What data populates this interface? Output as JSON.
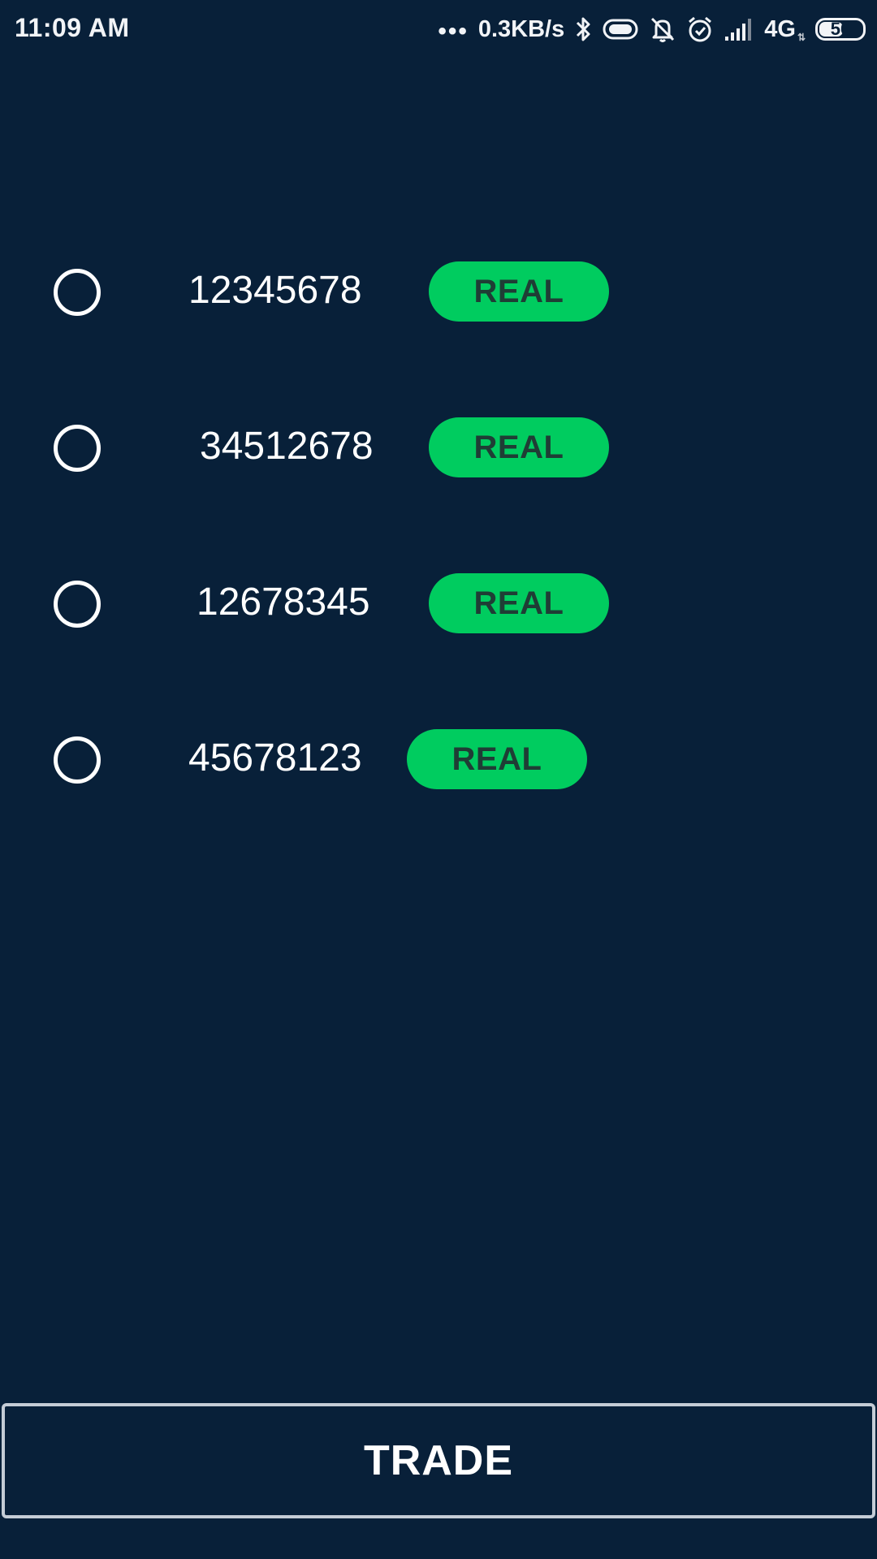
{
  "status_bar": {
    "time": "11:09 AM",
    "dots": "•••",
    "network_speed": "0.3KB/s",
    "network_type": "4G",
    "battery_level": "56",
    "battery_fraction": 0.56,
    "icons": [
      "bluetooth-icon",
      "vibrate-icon",
      "mute-bell-icon",
      "alarm-icon",
      "signal-icon",
      "battery-icon"
    ]
  },
  "accounts": [
    {
      "number": "12345678",
      "badge": "REAL",
      "selected": false
    },
    {
      "number": "34512678",
      "badge": "REAL",
      "selected": false
    },
    {
      "number": "12678345",
      "badge": "REAL",
      "selected": false
    },
    {
      "number": "45678123",
      "badge": "REAL",
      "selected": false
    }
  ],
  "trade_button": {
    "label": "TRADE"
  },
  "colors": {
    "background": "#082039",
    "badge": "#00cc5f",
    "badge_text": "#1f3d35",
    "button_border": "#c4ccd6"
  }
}
